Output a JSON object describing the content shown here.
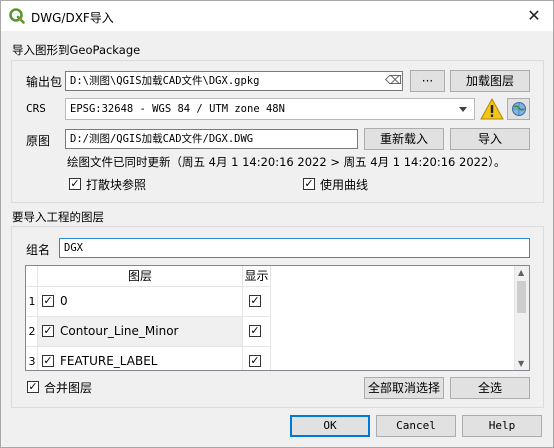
{
  "window": {
    "title": "DWG/DXF导入",
    "close_glyph": "✕"
  },
  "package_group": {
    "title": "导入图形到GeoPackage",
    "output_label": "输出包",
    "output_value": "D:\\测图\\QGIS加载CAD文件\\DGX.gpkg",
    "clear_glyph": "⌫",
    "browse_label": "···",
    "load_layers_label": "加载图层",
    "crs_label": "CRS",
    "crs_value": "EPSG:32648 - WGS 84 / UTM zone 48N",
    "source_label": "原图",
    "source_value": "D:/测图/QGIS加载CAD文件/DGX.DWG",
    "reload_label": "重新载入",
    "import_label": "导入",
    "info_text": "绘图文件已同时更新（周五 4月 1 14:20:16 2022 > 周五 4月 1 14:20:16 2022）。",
    "explode_label": "打散块参照",
    "explode_checked": true,
    "curves_label": "使用曲线",
    "curves_checked": true
  },
  "layers_group": {
    "title": "要导入工程的图层",
    "group_name_label": "组名",
    "group_name_value": "DGX",
    "columns": [
      "图层",
      "显示"
    ],
    "rows": [
      {
        "num": "1",
        "name": "0",
        "checked": true,
        "visible": true
      },
      {
        "num": "2",
        "name": "Contour_Line_Minor",
        "checked": true,
        "visible": true
      },
      {
        "num": "3",
        "name": "FEATURE_LABEL",
        "checked": true,
        "visible": true
      }
    ],
    "merge_label": "合并图层",
    "merge_checked": true,
    "deselect_all_label": "全部取消选择",
    "select_all_label": "全选"
  },
  "footer": {
    "ok": "OK",
    "cancel": "Cancel",
    "help": "Help"
  },
  "colors": {
    "accent": "#0078d7",
    "warning": "#f5c518",
    "qgis_green": "#589632"
  }
}
